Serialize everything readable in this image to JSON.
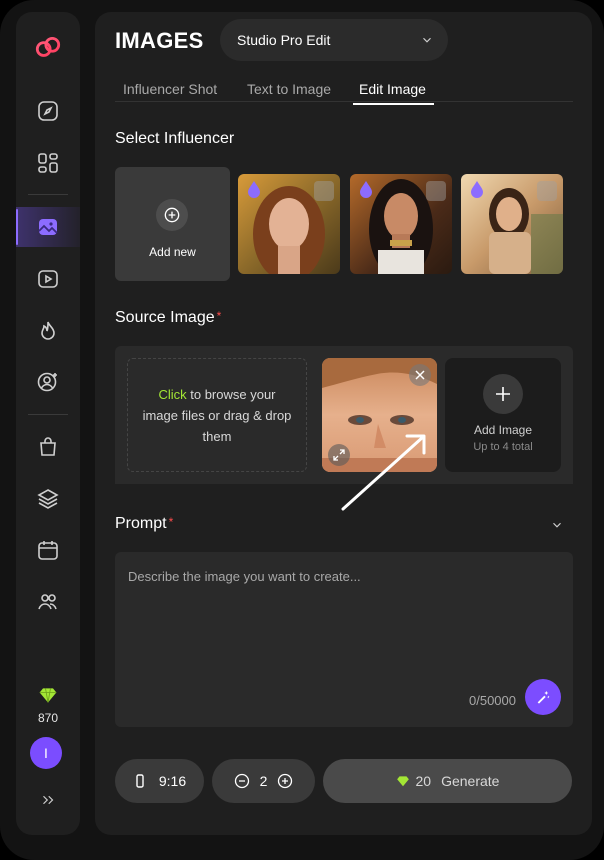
{
  "sidebar": {
    "credits": "870",
    "avatar_initial": "I",
    "expand_icon": "double-chevron-right-icon"
  },
  "header": {
    "title": "IMAGES",
    "model_select": "Studio Pro Edit"
  },
  "tabs": [
    {
      "label": "Influencer Shot",
      "active": false
    },
    {
      "label": "Text to Image",
      "active": false
    },
    {
      "label": "Edit Image",
      "active": true
    }
  ],
  "influencer": {
    "title": "Select Influencer",
    "add_new_label": "Add new"
  },
  "source": {
    "title": "Source Image",
    "required_mark": "*",
    "drop_accent": "Click",
    "drop_text": " to browse your image files or drag & drop them",
    "add_image_label": "Add Image",
    "add_image_sub": "Up to 4 total"
  },
  "prompt": {
    "title": "Prompt",
    "required_mark": "*",
    "placeholder": "Describe the image you want to create...",
    "counter": "0/50000"
  },
  "footer": {
    "aspect_ratio": "9:16",
    "quantity": "2",
    "cost": "20",
    "generate_label": "Generate"
  },
  "colors": {
    "accent_purple": "#7c4dff",
    "accent_green": "#a3e635",
    "required_red": "#ff4d4d",
    "panel_bg": "#1f1f1f"
  }
}
